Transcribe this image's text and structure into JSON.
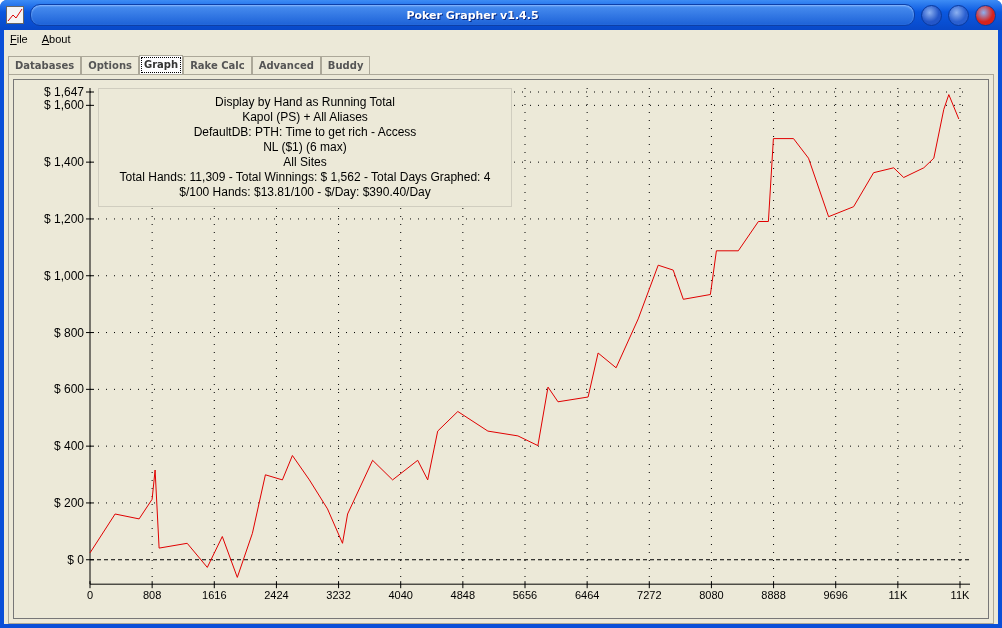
{
  "window": {
    "title": "Poker Grapher v1.4.5"
  },
  "menu": [
    "File",
    "About"
  ],
  "tabs": [
    {
      "label": "Databases",
      "selected": false
    },
    {
      "label": "Options",
      "selected": false
    },
    {
      "label": "Graph",
      "selected": true
    },
    {
      "label": "Rake Calc",
      "selected": false
    },
    {
      "label": "Advanced",
      "selected": false
    },
    {
      "label": "Buddy",
      "selected": false
    }
  ],
  "graph": {
    "info_lines": [
      "Display by Hand as Running Total",
      "Kapol (PS) + All Aliases",
      "DefaultDB: PTH: Time to get rich - Access",
      "NL ($1) (6 max)",
      "All Sites",
      "Total Hands: 11,309 - Total Winnings: $ 1,562 - Total Days Graphed: 4",
      "$/100 Hands: $13.81/100 - $/Day: $390.40/Day"
    ],
    "chart_data": {
      "type": "line",
      "grid": true,
      "xlim": [
        0,
        11312
      ],
      "ylim": [
        -86,
        1647
      ],
      "x": [
        0,
        326,
        638,
        808,
        847,
        899,
        1264,
        1525,
        1720,
        1915,
        2111,
        2280,
        2502,
        2632,
        2853,
        3088,
        3283,
        3349,
        3674,
        3935,
        4261,
        4391,
        4521,
        4782,
        5173,
        5564,
        5824,
        5955,
        6085,
        6476,
        6606,
        6841,
        7128,
        7388,
        7583,
        7714,
        8066,
        8144,
        8430,
        8691,
        8821,
        8886,
        9147,
        9342,
        9603,
        9929,
        10189,
        10450,
        10580,
        10841,
        10971,
        11101,
        11166,
        11296
      ],
      "series": [
        {
          "color": "#e00000",
          "values": [
            24,
            161,
            144,
            213,
            316,
            41,
            58,
            -27,
            82,
            -62,
            93,
            299,
            281,
            367,
            281,
            179,
            58,
            161,
            350,
            281,
            350,
            281,
            453,
            522,
            453,
            436,
            402,
            608,
            556,
            573,
            728,
            676,
            848,
            1037,
            1020,
            917,
            934,
            1088,
            1088,
            1191,
            1191,
            1483,
            1483,
            1414,
            1208,
            1243,
            1363,
            1380,
            1346,
            1380,
            1414,
            1586,
            1638,
            1552
          ]
        }
      ],
      "xticks": [
        0,
        808,
        1616,
        2424,
        3232,
        4040,
        4848,
        5656,
        6464,
        7272,
        8080,
        8888,
        9696,
        {
          "value": 10504,
          "label": "11K"
        },
        {
          "value": 11312,
          "label": "11K"
        }
      ],
      "yticks": [
        {
          "value": 0,
          "label": "$ 0"
        },
        {
          "value": 200,
          "label": "$ 200"
        },
        {
          "value": 400,
          "label": "$ 400"
        },
        {
          "value": 600,
          "label": "$ 600"
        },
        {
          "value": 800,
          "label": "$ 800"
        },
        {
          "value": 1000,
          "label": "$ 1,000"
        },
        {
          "value": 1200,
          "label": "$ 1,200"
        },
        {
          "value": 1400,
          "label": "$ 1,400"
        },
        {
          "value": 1600,
          "label": "$ 1,600"
        },
        {
          "value": 1647,
          "label": "$ 1,647"
        }
      ]
    }
  }
}
